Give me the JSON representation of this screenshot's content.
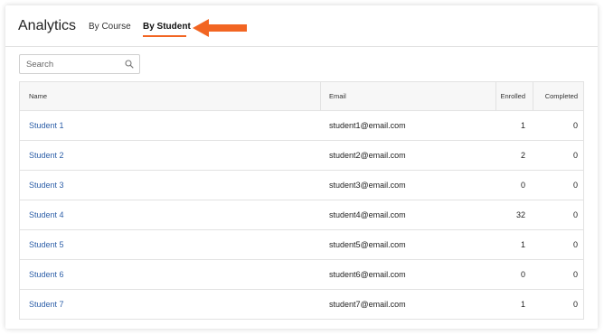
{
  "header": {
    "title": "Analytics",
    "tabs": [
      {
        "label": "By Course"
      },
      {
        "label": "By Student"
      }
    ]
  },
  "search": {
    "placeholder": "Search",
    "value": ""
  },
  "table": {
    "columns": {
      "name": "Name",
      "email": "Email",
      "enrolled": "Enrolled",
      "completed": "Completed"
    },
    "rows": [
      {
        "name": "Student 1",
        "email": "student1@email.com",
        "enrolled": "1",
        "completed": "0"
      },
      {
        "name": "Student 2",
        "email": "student2@email.com",
        "enrolled": "2",
        "completed": "0"
      },
      {
        "name": "Student 3",
        "email": "student3@email.com",
        "enrolled": "0",
        "completed": "0"
      },
      {
        "name": "Student 4",
        "email": "student4@email.com",
        "enrolled": "32",
        "completed": "0"
      },
      {
        "name": "Student 5",
        "email": "student5@email.com",
        "enrolled": "1",
        "completed": "0"
      },
      {
        "name": "Student 6",
        "email": "student6@email.com",
        "enrolled": "0",
        "completed": "0"
      },
      {
        "name": "Student 7",
        "email": "student7@email.com",
        "enrolled": "1",
        "completed": "0"
      }
    ]
  },
  "colors": {
    "accent": "#f26522",
    "link": "#2d5fa8"
  },
  "icons": {
    "search": "search-icon",
    "arrow": "arrow-left-icon"
  }
}
